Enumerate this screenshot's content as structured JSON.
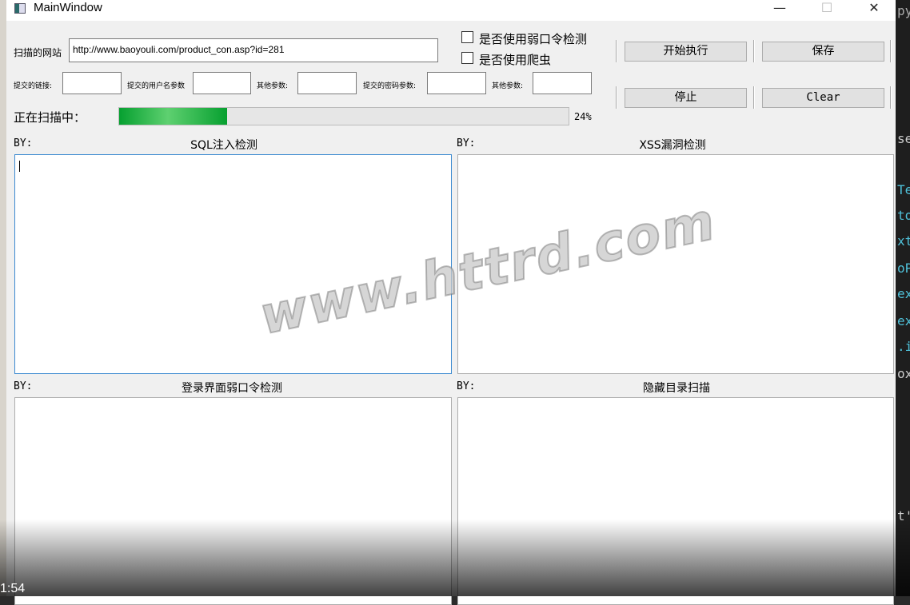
{
  "window": {
    "title": "MainWindow",
    "minimize": "—",
    "maximize": "☐",
    "close": "✕"
  },
  "scan": {
    "label": "扫描的网站",
    "url": "http://www.baoyouli.com/product_con.asp?id=281"
  },
  "options": [
    {
      "label": "是否使用弱口令检测",
      "checked": false
    },
    {
      "label": "是否使用爬虫",
      "checked": false
    }
  ],
  "params": [
    {
      "label": "提交的链接:",
      "value": ""
    },
    {
      "label": "提交的用户名参数",
      "value": ""
    },
    {
      "label": "其他参数:",
      "value": ""
    },
    {
      "label": "提交的密码参数:",
      "value": ""
    },
    {
      "label": "其他参数:",
      "value": ""
    }
  ],
  "buttons": {
    "start": "开始执行",
    "save": "保存",
    "stop": "停止",
    "clear": "Clear"
  },
  "progress": {
    "label": "正在扫描中：",
    "percent": 24,
    "text": "24%"
  },
  "panels": [
    {
      "by": "BY:",
      "title": "SQL注入检测",
      "content": ""
    },
    {
      "by": "BY:",
      "title": "XSS漏洞检测",
      "content": ""
    },
    {
      "by": "BY:",
      "title": "登录界面弱口令检测",
      "content": ""
    },
    {
      "by": "BY:",
      "title": "隐藏目录扫描",
      "content": ""
    }
  ],
  "watermark": "www.httrd.com",
  "video": {
    "time": "1:54"
  },
  "background_code": [
    "py",
    "se",
    "Te",
    "to",
    "xt",
    "oP",
    "ex",
    "ex",
    ".i",
    "ox",
    "t',"
  ]
}
